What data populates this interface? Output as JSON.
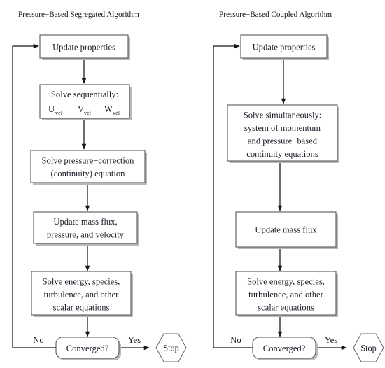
{
  "figure": {
    "type": "flowchart",
    "background": "#ffffff",
    "line_color": "#16161c",
    "box_border_color": "#55555f",
    "box_fill": "#ffffff"
  },
  "columns": [
    {
      "id": "segregated",
      "title": "Pressure−Based Segregated Algorithm",
      "nodes": [
        {
          "id": "seg-update-properties",
          "shape": "rect",
          "lines": [
            "Update properties"
          ]
        },
        {
          "id": "seg-solve-sequentially",
          "shape": "rect",
          "lines": [
            "Solve sequentially:"
          ],
          "variables": [
            {
              "base": "U",
              "sub": "vel"
            },
            {
              "base": "V",
              "sub": "vel"
            },
            {
              "base": "W",
              "sub": "vel"
            }
          ]
        },
        {
          "id": "seg-pressure-correction",
          "shape": "rect",
          "lines": [
            "Solve pressure−correction",
            "(continuity) equation"
          ]
        },
        {
          "id": "seg-update-mass-flux",
          "shape": "rect",
          "lines": [
            "Update mass flux,",
            "pressure, and velocity"
          ]
        },
        {
          "id": "seg-solve-energy",
          "shape": "rect",
          "lines": [
            "Solve energy, species,",
            "turbulence, and other",
            "scalar equations"
          ]
        },
        {
          "id": "seg-converged",
          "shape": "rounded-rect",
          "lines": [
            "Converged?"
          ]
        },
        {
          "id": "seg-stop",
          "shape": "hexagon",
          "lines": [
            "Stop"
          ]
        }
      ],
      "edge_labels": {
        "no": "No",
        "yes": "Yes"
      }
    },
    {
      "id": "coupled",
      "title": "Pressure−Based Coupled Algorithm",
      "nodes": [
        {
          "id": "cou-update-properties",
          "shape": "rect",
          "lines": [
            "Update properties"
          ]
        },
        {
          "id": "cou-solve-simultaneously",
          "shape": "rect",
          "lines": [
            "Solve simultaneously:",
            "system of momentum",
            "and pressure−based",
            "continuity equations"
          ]
        },
        {
          "id": "cou-update-mass-flux",
          "shape": "rect",
          "lines": [
            "Update mass flux"
          ]
        },
        {
          "id": "cou-solve-energy",
          "shape": "rect",
          "lines": [
            "Solve energy, species,",
            "turbulence, and other",
            "scalar equations"
          ]
        },
        {
          "id": "cou-converged",
          "shape": "rounded-rect",
          "lines": [
            "Converged?"
          ]
        },
        {
          "id": "cou-stop",
          "shape": "hexagon",
          "lines": [
            "Stop"
          ]
        }
      ],
      "edge_labels": {
        "no": "No",
        "yes": "Yes"
      }
    }
  ]
}
